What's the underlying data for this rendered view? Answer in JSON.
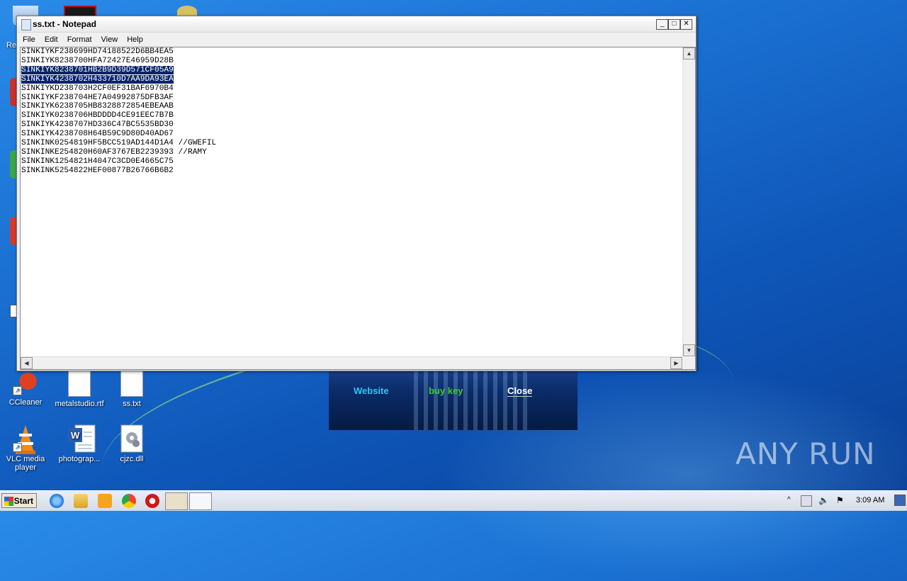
{
  "desktop": {
    "icons": [
      {
        "label": "CCleaner"
      },
      {
        "label": "metalstudio.rtf"
      },
      {
        "label": "ss.txt"
      },
      {
        "label": "VLC media player"
      },
      {
        "label": "photograp..."
      },
      {
        "label": "cjzc.dll"
      }
    ],
    "fragment_label": "Re"
  },
  "popup": {
    "links": [
      {
        "label": "Website",
        "color": "#2ec8f0"
      },
      {
        "label": "buy key",
        "color": "#33d13a"
      },
      {
        "label": "Close",
        "color": "#ffffff"
      }
    ]
  },
  "notepad": {
    "title": "ss.txt - Notepad",
    "menu": [
      "File",
      "Edit",
      "Format",
      "View",
      "Help"
    ],
    "lines": [
      {
        "text": "SINKIYKF238699HD74188522D6BB4EA5",
        "selected": false
      },
      {
        "text": "SINKIYK8238700HFA72427E46959D28B",
        "selected": false
      },
      {
        "text": "SINKIYK8238701HB2B9D39D571CF05A9",
        "selected": true
      },
      {
        "text": "SINKIYK4238702H433710D7AA9DA93EA",
        "selected": true
      },
      {
        "text": "SINKIYKD238703H2CF0EF31BAF6970B4",
        "selected": false
      },
      {
        "text": "SINKIYKF238704HE7A04992875DFB3AF",
        "selected": false
      },
      {
        "text": "SINKIYK6238705HB8328872854EBEAAB",
        "selected": false
      },
      {
        "text": "SINKIYK0238706HBDDDD4CE91EEC7B7B",
        "selected": false
      },
      {
        "text": "SINKIYK4238707HD336C47BC5535BD30",
        "selected": false
      },
      {
        "text": "SINKIYK4238708H64B59C9D80D40AD67",
        "selected": false
      },
      {
        "text": "SINKINK0254819HF5BCC519AD144D1A4 //GWEFIL",
        "selected": false
      },
      {
        "text": "SINKINKE254820H60AF3767EB2239393 //RAMY",
        "selected": false
      },
      {
        "text": "SINKINK1254821H4047C3CD0E4665C75",
        "selected": false
      },
      {
        "text": "SINKINK5254822HEF00877B26766B6B2",
        "selected": false
      }
    ]
  },
  "taskbar": {
    "start_label": "Start",
    "clock": "3:09 AM"
  },
  "watermark": "ANY RUN"
}
